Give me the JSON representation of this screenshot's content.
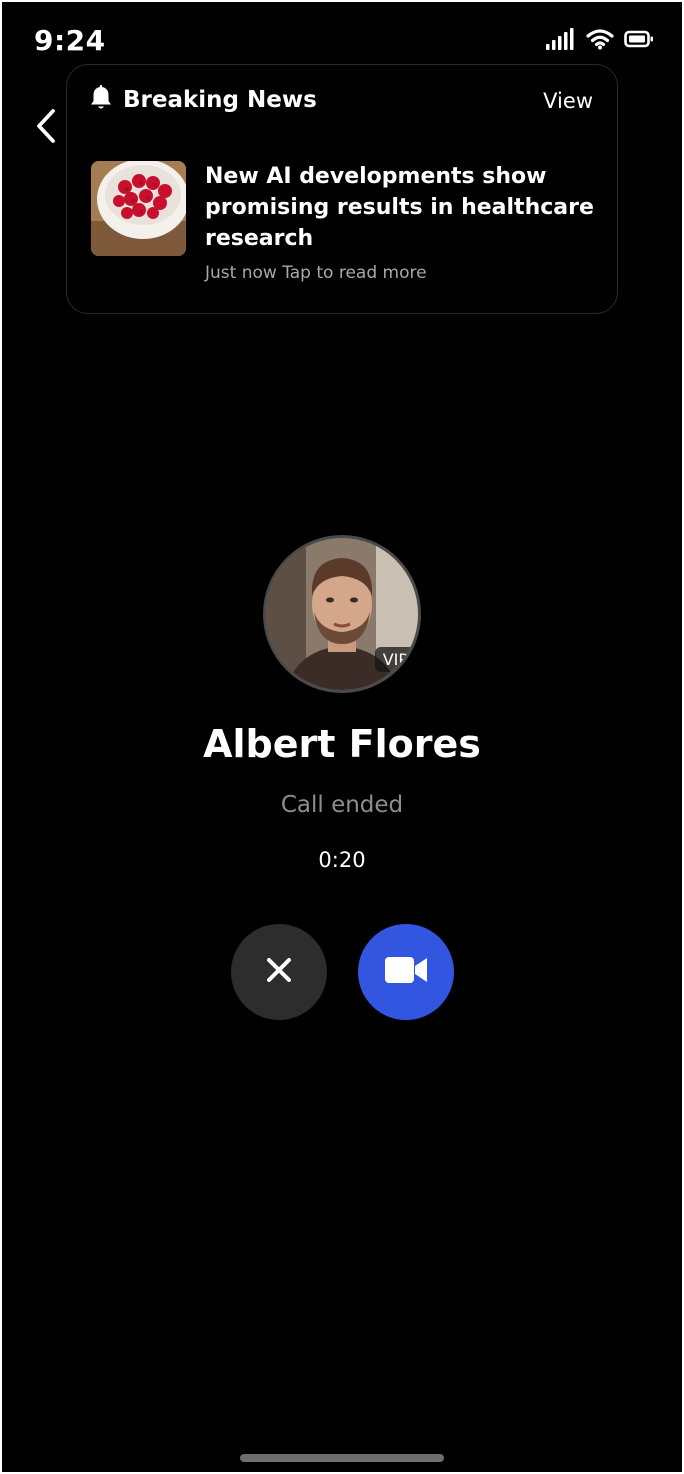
{
  "status_bar": {
    "time": "9:24",
    "icons": [
      "signal-icon",
      "wifi-icon",
      "battery-icon"
    ]
  },
  "navigation": {
    "back_icon": "chevron-left-icon"
  },
  "notification": {
    "icon": "bell-icon",
    "title": "Breaking News",
    "action_label": "View",
    "thumbnail": "raspberries-bowl-image",
    "headline": "New AI developments show promising results in healthcare research",
    "meta": "Just now Tap to read more"
  },
  "call": {
    "caller_name": "Albert Flores",
    "badge": "VIP",
    "status": "Call ended",
    "duration": "0:20",
    "actions": [
      {
        "name": "close",
        "icon": "close-icon",
        "color": "#2d2d2d"
      },
      {
        "name": "video",
        "icon": "video-camera-icon",
        "color": "#3356e0"
      }
    ]
  },
  "colors": {
    "background": "#000000",
    "accent": "#3356e0",
    "muted_text": "#8d8d8d"
  }
}
